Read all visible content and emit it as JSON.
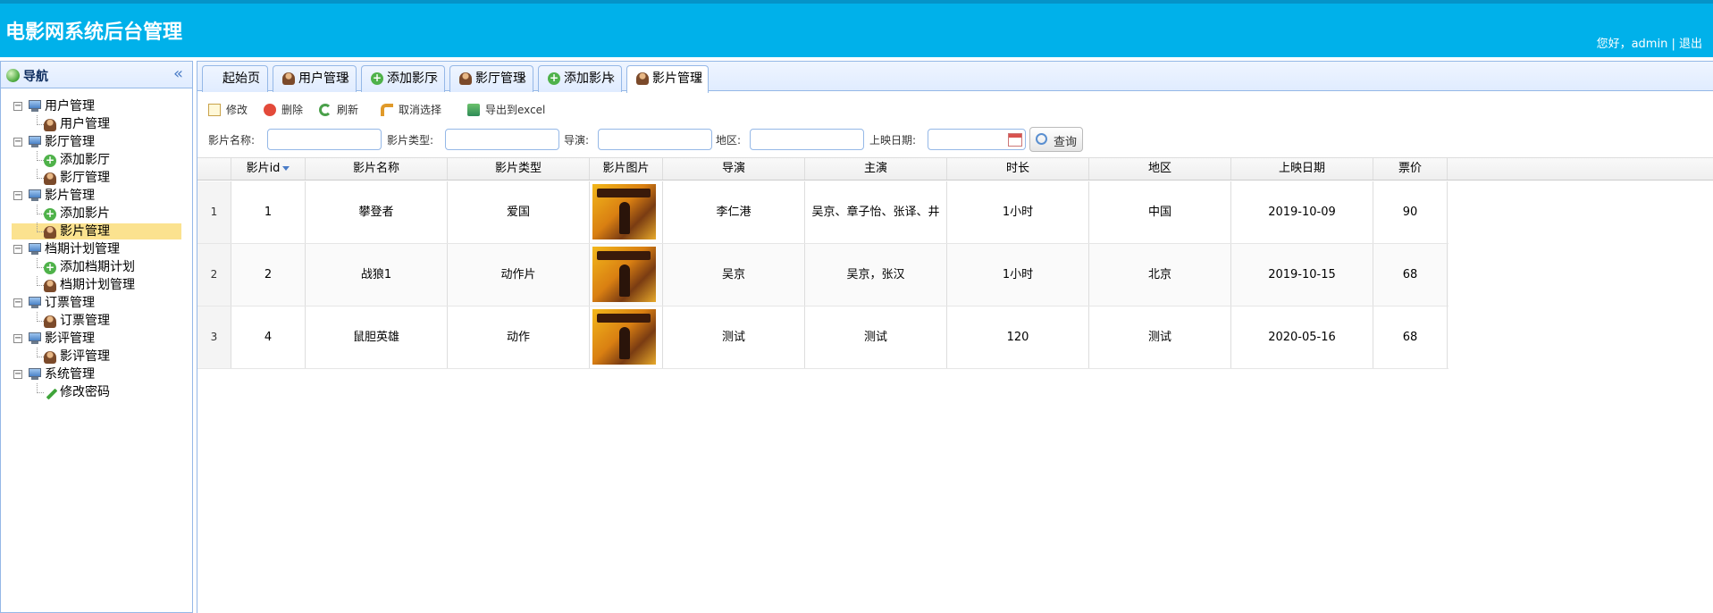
{
  "header": {
    "title": "电影网系统后台管理",
    "greeting": "您好，admin",
    "separator": " | ",
    "logout": "退出"
  },
  "sidebar": {
    "title": "导航",
    "collapse_glyph": "«",
    "groups": [
      {
        "label": "用户管理",
        "children": [
          {
            "label": "用户管理",
            "icon": "user-icon"
          }
        ]
      },
      {
        "label": "影厅管理",
        "children": [
          {
            "label": "添加影厅",
            "icon": "add-icon"
          },
          {
            "label": "影厅管理",
            "icon": "user-icon"
          }
        ]
      },
      {
        "label": "影片管理",
        "children": [
          {
            "label": "添加影片",
            "icon": "add-icon"
          },
          {
            "label": "影片管理",
            "icon": "user-icon",
            "selected": true
          }
        ]
      },
      {
        "label": "档期计划管理",
        "children": [
          {
            "label": "添加档期计划",
            "icon": "add-icon"
          },
          {
            "label": "档期计划管理",
            "icon": "user-icon"
          }
        ]
      },
      {
        "label": "订票管理",
        "children": [
          {
            "label": "订票管理",
            "icon": "user-icon"
          }
        ]
      },
      {
        "label": "影评管理",
        "children": [
          {
            "label": "影评管理",
            "icon": "user-icon"
          }
        ]
      },
      {
        "label": "系统管理",
        "children": [
          {
            "label": "修改密码",
            "icon": "pencil-icon"
          }
        ]
      }
    ]
  },
  "tabs": [
    {
      "label": "起始页",
      "icon": "",
      "closable": false
    },
    {
      "label": "用户管理",
      "icon": "user-icon",
      "closable": true
    },
    {
      "label": "添加影厅",
      "icon": "add-icon",
      "closable": true
    },
    {
      "label": "影厅管理",
      "icon": "user-icon",
      "closable": true
    },
    {
      "label": "添加影片",
      "icon": "add-icon",
      "closable": true
    },
    {
      "label": "影片管理",
      "icon": "user-icon",
      "closable": true,
      "active": true
    }
  ],
  "close_glyph": "×",
  "toolbar": {
    "edit": "修改",
    "delete": "删除",
    "refresh": "刷新",
    "cancel_select": "取消选择",
    "export": "导出到excel"
  },
  "filters": {
    "name_label": "影片名称:",
    "type_label": "影片类型:",
    "director_label": "导演:",
    "region_label": "地区:",
    "date_label": "上映日期:",
    "name_value": "",
    "type_value": "",
    "director_value": "",
    "region_value": "",
    "date_value": "",
    "search": "查询"
  },
  "grid": {
    "columns": [
      "影片id",
      "影片名称",
      "影片类型",
      "影片图片",
      "导演",
      "主演",
      "时长",
      "地区",
      "上映日期",
      "票价"
    ],
    "rows": [
      {
        "rownum": "1",
        "id": "1",
        "name": "攀登者",
        "type": "爱国",
        "director": "李仁港",
        "actors": "吴京、章子怡、张译、井",
        "duration": "1小时",
        "region": "中国",
        "date": "2019-10-09",
        "price": "90"
      },
      {
        "rownum": "2",
        "id": "2",
        "name": "战狼1",
        "type": "动作片",
        "director": "吴京",
        "actors": "吴京，张汉",
        "duration": "1小时",
        "region": "北京",
        "date": "2019-10-15",
        "price": "68"
      },
      {
        "rownum": "3",
        "id": "4",
        "name": "鼠胆英雄",
        "type": "动作",
        "director": "测试",
        "actors": "测试",
        "duration": "120",
        "region": "测试",
        "date": "2020-05-16",
        "price": "68"
      }
    ]
  }
}
